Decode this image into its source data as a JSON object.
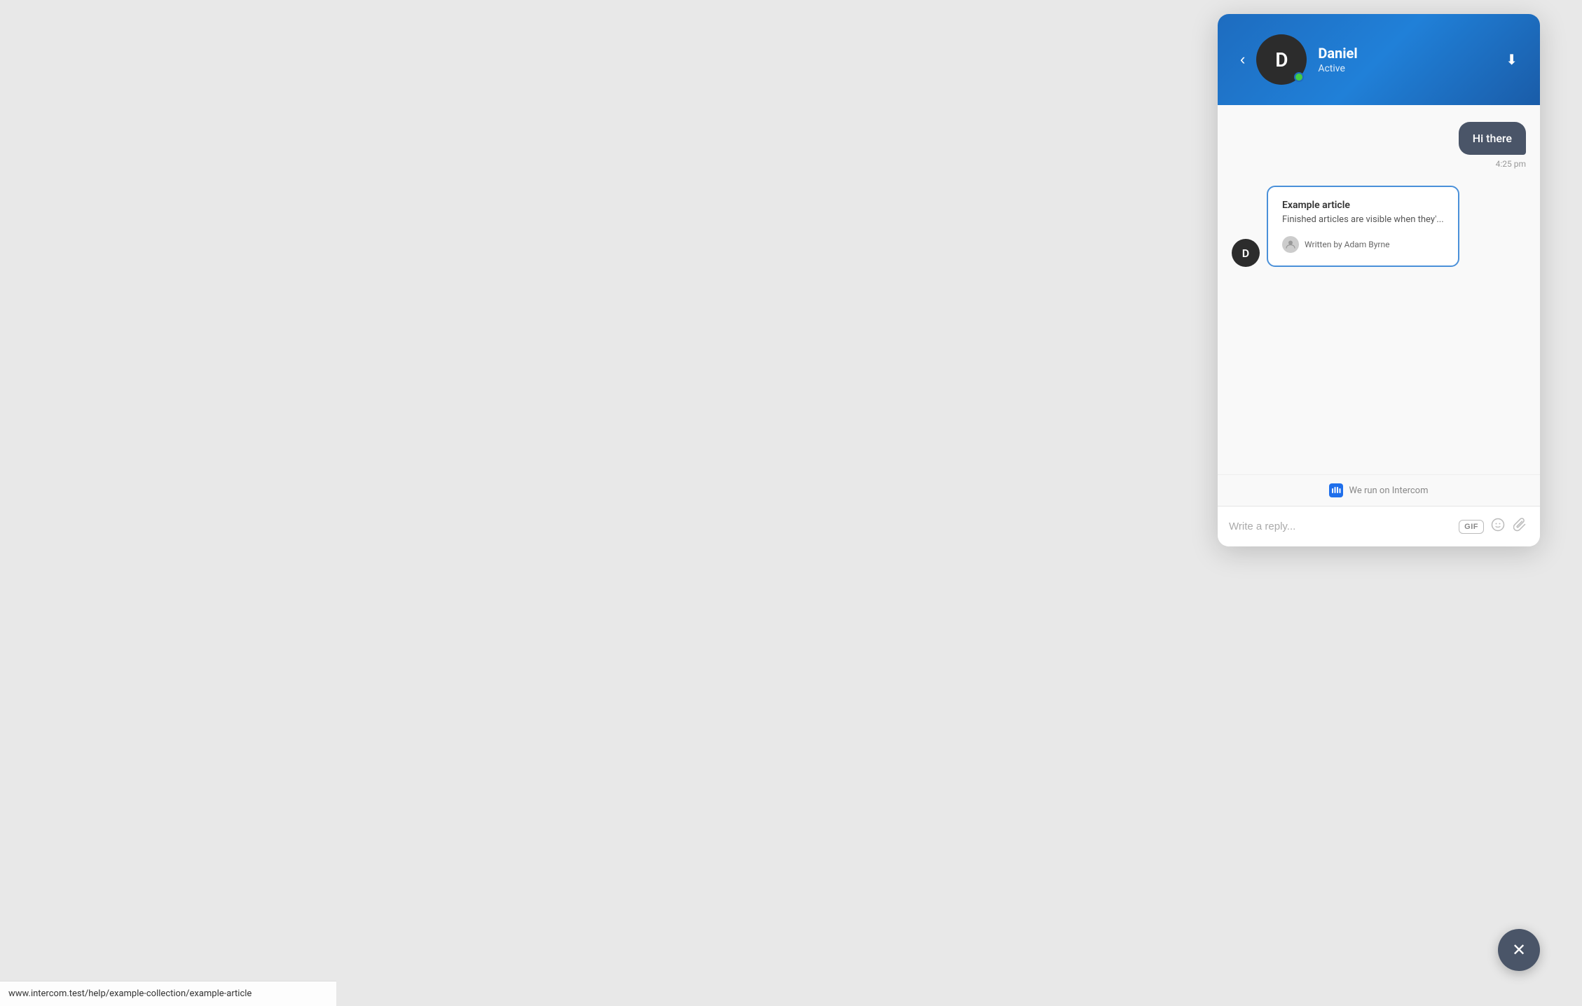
{
  "page": {
    "background_color": "#e8e8e8"
  },
  "header": {
    "back_label": "‹",
    "download_label": "⬇",
    "user": {
      "initial": "D",
      "name": "Daniel",
      "status": "Active"
    }
  },
  "messages": {
    "sent": {
      "text": "Hi there",
      "time": "4:25 pm"
    },
    "received": {
      "sender_initial": "D",
      "article": {
        "title": "Example article",
        "excerpt": "Finished articles are visible when they'...",
        "author_label": "Written by Adam Byrne"
      }
    }
  },
  "branding": {
    "text": "We run on Intercom"
  },
  "input": {
    "placeholder": "Write a reply...",
    "gif_label": "GIF"
  },
  "close_button": {
    "label": "✕"
  },
  "status_bar": {
    "url": "www.intercom.test/help/example-collection/example-article"
  }
}
